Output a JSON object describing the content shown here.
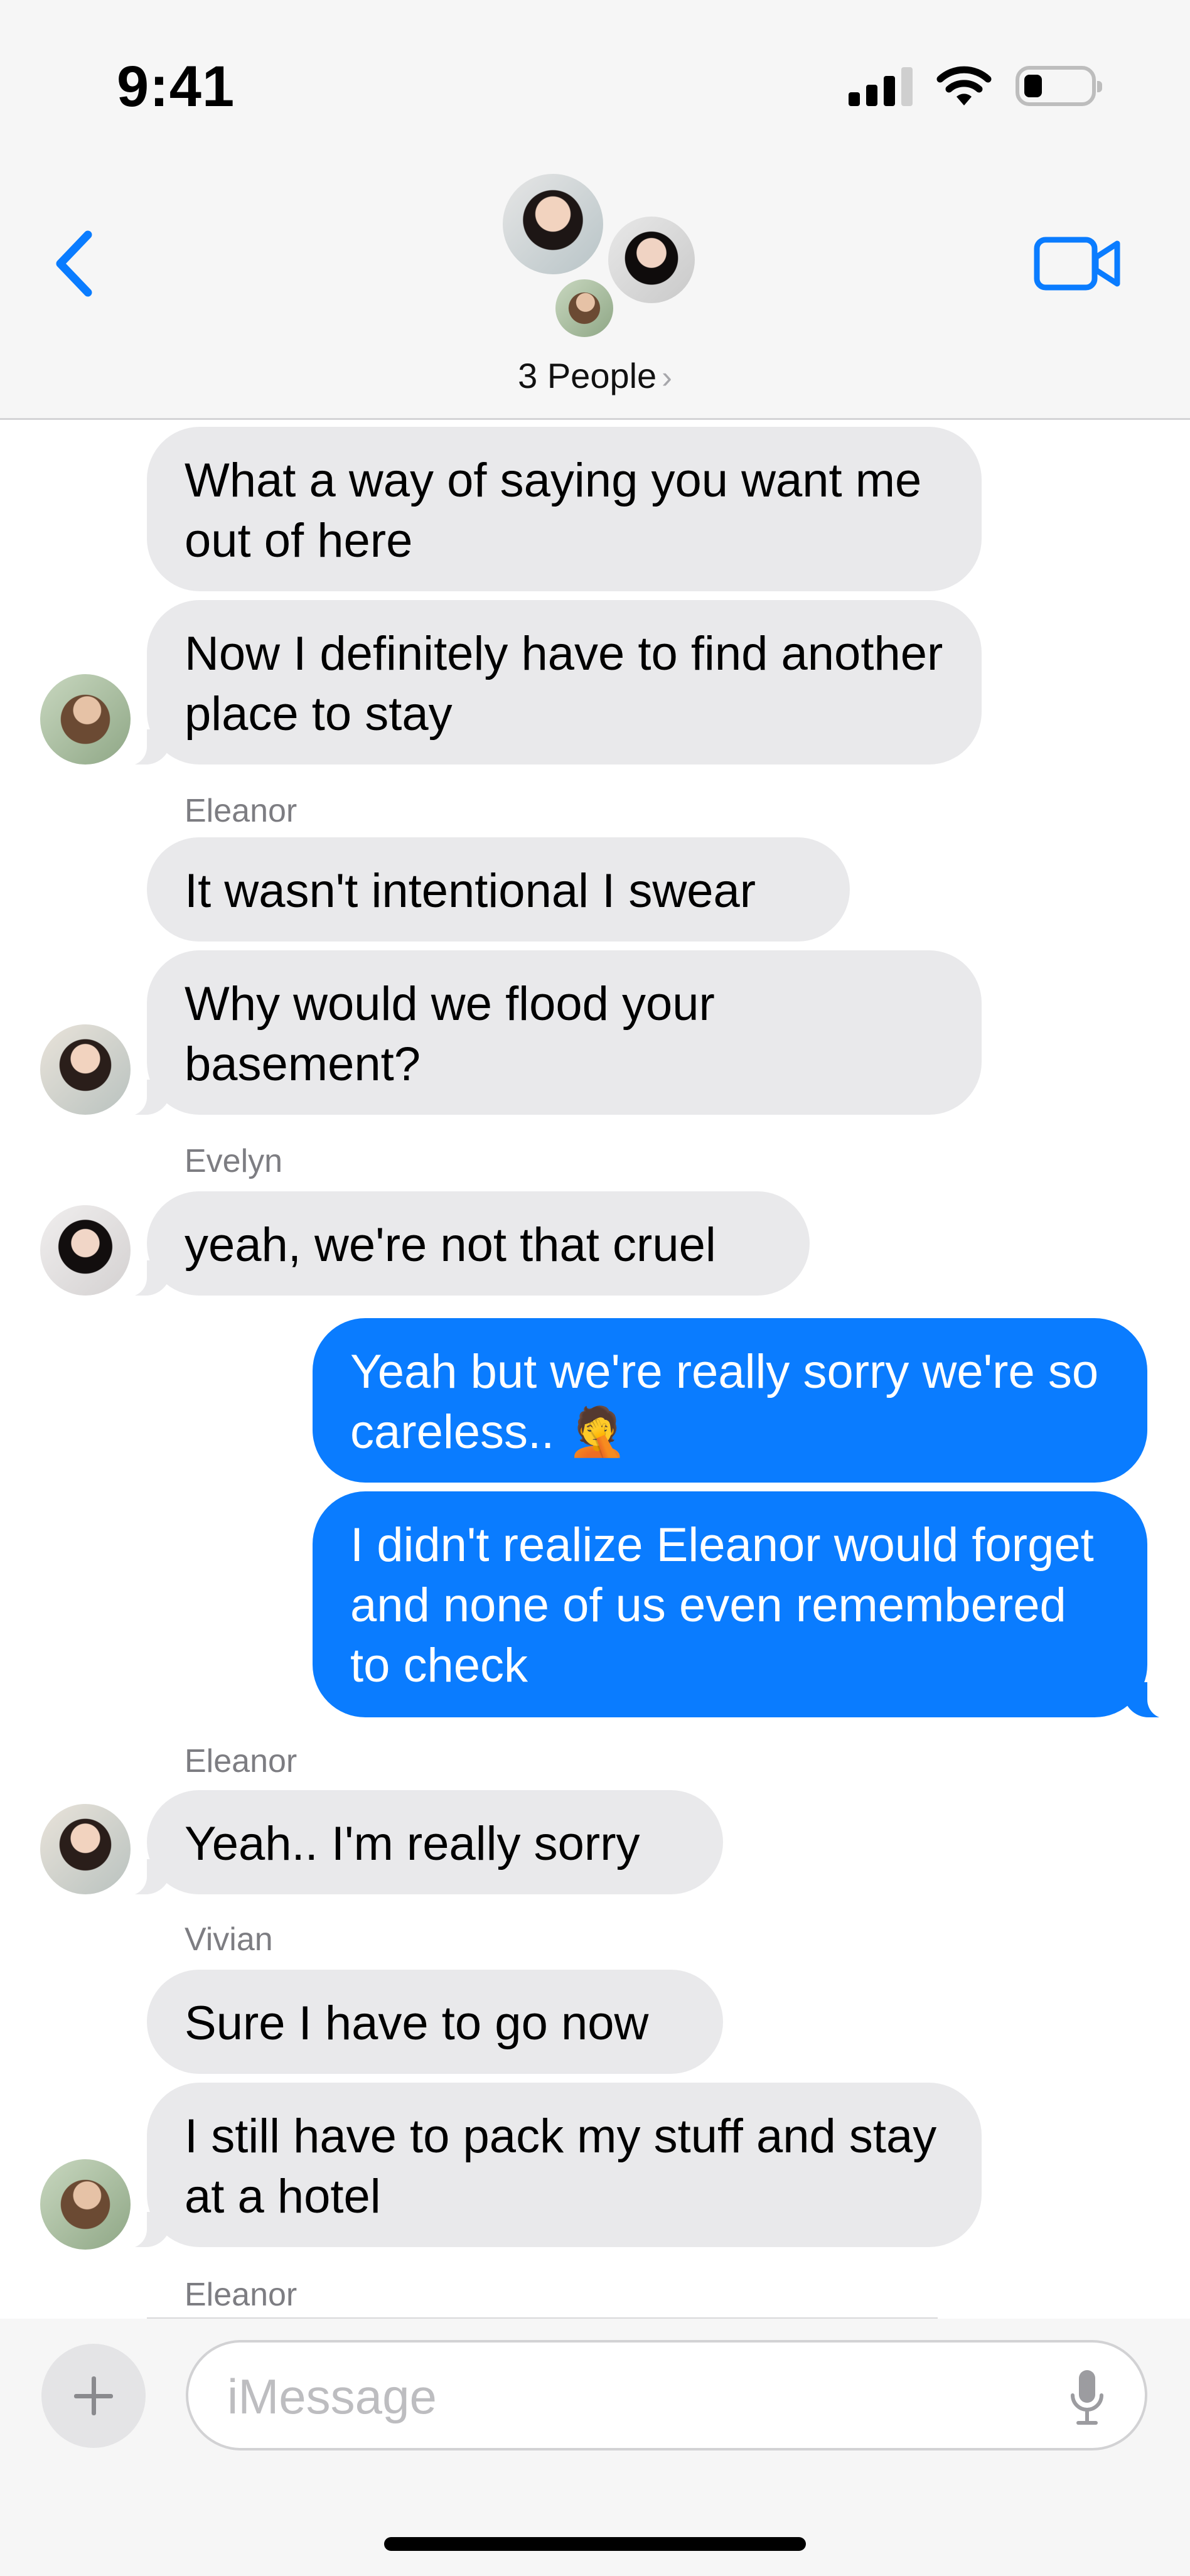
{
  "status_bar": {
    "time": "9:41"
  },
  "header": {
    "title": "3 People",
    "chevron": "›"
  },
  "messages": [
    {
      "sender": "",
      "text": "What a way of saying you want me out of here",
      "direction": "incoming"
    },
    {
      "sender": "",
      "text": "Now I definitely have to find another place to stay",
      "direction": "incoming",
      "avatar": "vivian"
    },
    {
      "sender": "Eleanor",
      "text": "It wasn't intentional I swear",
      "direction": "incoming"
    },
    {
      "sender": "",
      "text": "Why would we flood your basement?",
      "direction": "incoming",
      "avatar": "eleanor"
    },
    {
      "sender": "Evelyn",
      "text": "yeah, we're not that cruel",
      "direction": "incoming",
      "avatar": "evelyn"
    },
    {
      "sender": "",
      "text": "Yeah but we're really sorry we're so careless.. 🤦",
      "direction": "outgoing"
    },
    {
      "sender": "",
      "text": "I didn't realize Eleanor would forget and none of us even remembered to check",
      "direction": "outgoing"
    },
    {
      "sender": "Eleanor",
      "text": "Yeah.. I'm really sorry",
      "direction": "incoming",
      "avatar": "eleanor"
    },
    {
      "sender": "Vivian",
      "text": "Sure I have to go now",
      "direction": "incoming"
    },
    {
      "sender": "",
      "text": "I still have to pack my stuff and stay at a hotel",
      "direction": "incoming",
      "avatar": "vivian"
    },
    {
      "sender": "Eleanor",
      "text": "",
      "direction": "incoming"
    }
  ],
  "composer": {
    "placeholder": "iMessage"
  },
  "icons": {
    "back": "chevron-left-icon",
    "video": "video-camera-icon",
    "add": "plus-icon",
    "mic": "microphone-icon"
  },
  "colors": {
    "accent": "#0a7cff",
    "incoming_bubble": "#e9e9eb",
    "header_bg": "#f6f6f6"
  }
}
